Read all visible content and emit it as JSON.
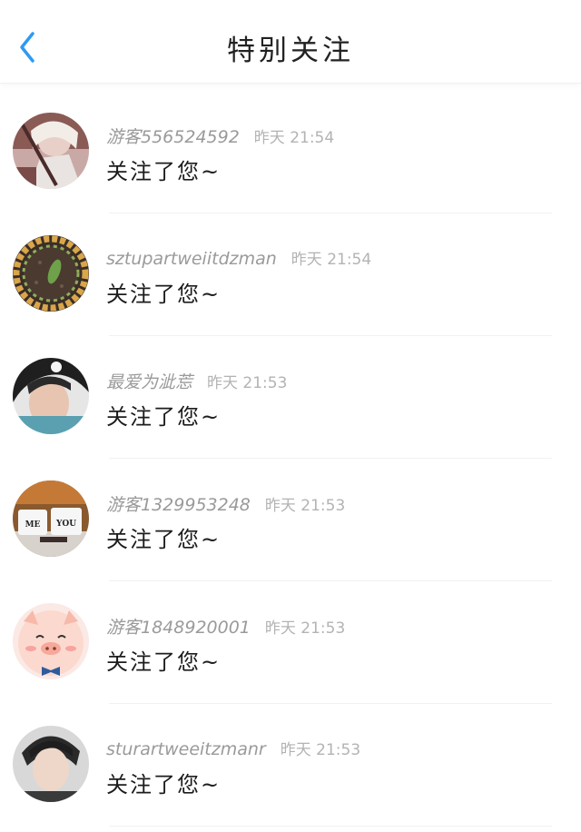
{
  "header": {
    "title": "特别关注",
    "back_icon": "chevron-left-icon",
    "accent_color": "#2f9af2"
  },
  "items": [
    {
      "username": "游客556524592",
      "time": "昨天 21:54",
      "message": "关注了您~",
      "avatar": "anime-character-avatar"
    },
    {
      "username": "sztupartweiitdzman",
      "time": "昨天 21:54",
      "message": "关注了您~",
      "avatar": "leaf-plate-avatar"
    },
    {
      "username": "最爱为泚莣",
      "time": "昨天 21:53",
      "message": "关注了您~",
      "avatar": "portrait-avatar"
    },
    {
      "username": "游客1329953248",
      "time": "昨天 21:53",
      "message": "关注了您~",
      "avatar": "me-you-cups-avatar"
    },
    {
      "username": "游客1848920001",
      "time": "昨天 21:53",
      "message": "关注了您~",
      "avatar": "pig-cartoon-avatar"
    },
    {
      "username": "sturartweeitzmanr",
      "time": "昨天 21:53",
      "message": "关注了您~",
      "avatar": "young-man-avatar"
    }
  ]
}
